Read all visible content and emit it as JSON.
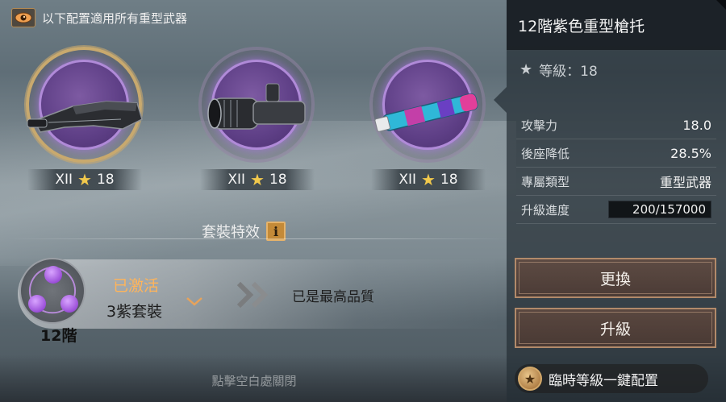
{
  "top_note": {
    "text": "以下配置適用所有重型武器",
    "icon": "eye-icon"
  },
  "slots": [
    {
      "tier": "XII",
      "level": "18",
      "item": "heavy-stock",
      "selected": true
    },
    {
      "tier": "XII",
      "level": "18",
      "item": "scope",
      "selected": false
    },
    {
      "tier": "XII",
      "level": "18",
      "item": "suppressor",
      "selected": false
    }
  ],
  "set_effect": {
    "title": "套裝特效",
    "status": "已激活",
    "set_count": "3紫套裝",
    "tier": "12階",
    "max_quality": "已是最高品質"
  },
  "close_hint": "點擊空白處關閉",
  "panel": {
    "title": "12階紫色重型槍托",
    "level_label": "等級：18",
    "stats": [
      {
        "label": "攻擊力",
        "value": "18.0"
      },
      {
        "label": "後座降低",
        "value": "28.5%"
      },
      {
        "label": "專屬類型",
        "value": "重型武器"
      }
    ],
    "progress": {
      "label": "升級進度",
      "value": "200/157000",
      "current": 200,
      "max": 157000
    },
    "replace_label": "更換",
    "upgrade_label": "升級",
    "quick_config_label": "臨時等級一鍵配置"
  },
  "colors": {
    "accent_gold": "#f2c94c",
    "purple_quality": "#9b4fd8",
    "active_orange": "#ffb45a",
    "button_border": "#b28a6a"
  }
}
